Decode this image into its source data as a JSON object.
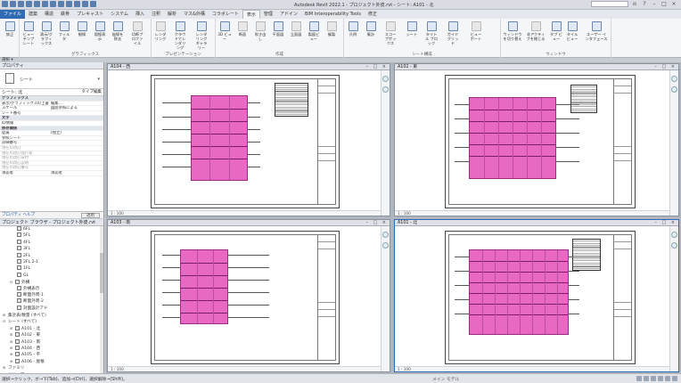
{
  "window": {
    "title": "Autodesk Revit 2022.1 - プロジェクト外皮.rvt - シート: A101 - 北",
    "search_placeholder": ""
  },
  "tabs": [
    "ファイル",
    "建築",
    "構造",
    "鉄骨",
    "プレキャスト",
    "システム",
    "挿入",
    "注釈",
    "解析",
    "マス&外構",
    "コラボレート",
    "表示",
    "管理",
    "アドイン",
    "BIM Interoperability Tools",
    "修正"
  ],
  "ribbon": {
    "groups": [
      {
        "title": "",
        "buttons": [
          "修正"
        ]
      },
      {
        "title": "グラフィックス",
        "buttons": [
          "ビュー テンプレート",
          "表示/グラフィックス",
          "フィルタ",
          "細線",
          "隠線表示",
          "陰線を除去",
          "切断プロファイル"
        ]
      },
      {
        "title": "プレゼンテーション",
        "buttons": [
          "レンダリング",
          "クラウドでレンダリング",
          "レンダリング ギャラリー"
        ]
      },
      {
        "title": "作成",
        "buttons": [
          "3D ビュー",
          "断面",
          "吹き出し",
          "平面図",
          "立面図",
          "製図ビュー",
          "複製"
        ]
      },
      {
        "title": "シート構成",
        "buttons": [
          "凡例",
          "集計",
          "スコープボックス",
          "シート",
          "タイトル ブロック",
          "ガイド グリッド",
          "ビューポート"
        ]
      },
      {
        "title": "ウィンドウ",
        "buttons": [
          "ウィンドウを切り替え",
          "非アクティブを閉じる",
          "タブ ビュー",
          "タイル ビュー",
          "ユーザー インタフェース"
        ]
      }
    ],
    "select_label": "選択 ▾"
  },
  "properties": {
    "title": "プロパティ",
    "type_label": "シート",
    "filter_label": "シート: 北",
    "type_edit": "タイプ編集",
    "rows": [
      {
        "k": "グラフィックス",
        "v": "",
        "cat": true
      },
      {
        "k": "表示/グラフィックスの上書き",
        "v": "編集..."
      },
      {
        "k": "スケール",
        "v": "図面参照による"
      },
      {
        "k": "シート番号",
        "v": ""
      },
      {
        "k": "文字",
        "v": "",
        "cat": true
      },
      {
        "k": "ID情報",
        "v": ""
      },
      {
        "k": "依存関係",
        "v": "",
        "cat": true
      },
      {
        "k": "従属",
        "v": "(独立)"
      },
      {
        "k": "参照シート",
        "v": ""
      },
      {
        "k": "詳細番号",
        "v": ""
      },
      {
        "k": "現在の改訂",
        "v": "",
        "gray": true
      },
      {
        "k": "現在の改訂発行者",
        "v": "",
        "gray": true
      },
      {
        "k": "現在の改訂日付",
        "v": "",
        "gray": true
      },
      {
        "k": "現在の改訂説明",
        "v": "",
        "gray": true
      },
      {
        "k": "現在の改訂番号",
        "v": "",
        "gray": true
      },
      {
        "k": "承認者",
        "v": "承認者"
      }
    ],
    "help_link": "プロパティ ヘルプ",
    "apply": "適用"
  },
  "browser": {
    "title": "プロジェクト ブラウザ - プロジェクト外皮.rvt",
    "items": [
      {
        "label": "6FL",
        "depth": 2
      },
      {
        "label": "5FL",
        "depth": 2
      },
      {
        "label": "4FL",
        "depth": 2
      },
      {
        "label": "3FL",
        "depth": 2
      },
      {
        "label": "2FL",
        "depth": 2
      },
      {
        "label": "2FL 2-1",
        "depth": 2
      },
      {
        "label": "1FL",
        "depth": 2
      },
      {
        "label": "GL",
        "depth": 2
      },
      {
        "label": "外構",
        "depth": 1,
        "twist": "⊟"
      },
      {
        "label": "外構表示",
        "depth": 2
      },
      {
        "label": "断面外周-1",
        "depth": 2
      },
      {
        "label": "断面外周-2",
        "depth": 2
      },
      {
        "label": "対面設計アド",
        "depth": 2
      },
      {
        "label": "集計表/数量 (すべて)",
        "depth": 0,
        "twist": "⊞"
      },
      {
        "label": "シート (すべて)",
        "depth": 0,
        "twist": "⊟"
      },
      {
        "label": "A101 - 北",
        "depth": 1,
        "twist": "⊞"
      },
      {
        "label": "A102 - 東",
        "depth": 1,
        "twist": "⊞"
      },
      {
        "label": "A103 - 南",
        "depth": 1,
        "twist": "⊞"
      },
      {
        "label": "A104 - 西",
        "depth": 1,
        "twist": "⊞"
      },
      {
        "label": "A105 - 平",
        "depth": 1,
        "twist": "⊞"
      },
      {
        "label": "A106 - 屋根",
        "depth": 1,
        "twist": "⊞"
      },
      {
        "label": "ファミリ",
        "depth": 0,
        "twist": "⊞"
      },
      {
        "label": "グループ",
        "depth": 0,
        "twist": "⊞"
      },
      {
        "label": "Revit リンク",
        "depth": 0,
        "twist": "⊞"
      }
    ]
  },
  "views": [
    {
      "title": "A104 - 西",
      "status": "1 : 100"
    },
    {
      "title": "A102 - 東",
      "status": "1 : 100"
    },
    {
      "title": "A103 - 南",
      "status": "1 : 100"
    },
    {
      "title": "A101 - 北",
      "status": "1 : 100"
    }
  ],
  "statusbar": {
    "hint": "選択→クリック、ボ→下(Tab)、追加→(Ctrl)、選択解除→(Shift)。",
    "model": "メイン モデル"
  },
  "colors": {
    "accent": "#2f6bb3",
    "building": "#e868c4"
  }
}
